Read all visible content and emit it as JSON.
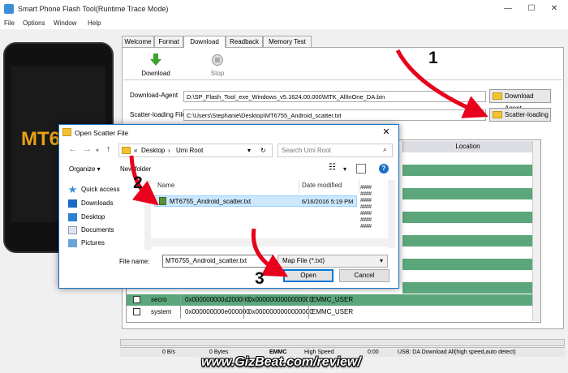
{
  "window": {
    "title": "Smart Phone Flash Tool(Runtime Trace Mode)",
    "minimize_icon": "minimize-icon",
    "maximize_icon": "maximize-icon",
    "close_glyph": "✕"
  },
  "menu": [
    "File",
    "Options",
    "Window",
    "Help"
  ],
  "phone": {
    "logo": "MT6"
  },
  "tabs": [
    "Welcome",
    "Format",
    "Download",
    "Readback",
    "Memory Test"
  ],
  "active_tab": "Download",
  "toolbar": {
    "download": "Download",
    "stop": "Stop"
  },
  "download_agent": {
    "label": "Download-Agent",
    "value": "D:\\SP_Flash_Tool_exe_Windows_v5.1624.00.000\\MTK_AllInOne_DA.bin",
    "button": "Download Agent"
  },
  "scatter": {
    "label": "Scatter-loading File",
    "value": "C:\\Users\\Stephanie\\Desktop\\MT6755_Android_scatter.txt",
    "button": "Scatter-loading"
  },
  "partition_table": {
    "location_header": "Location",
    "rows": [
      {
        "name": "secro",
        "begin": "0x000000000d200000",
        "end": "0x0000000000000000",
        "region": "EMMC_USER"
      },
      {
        "name": "system",
        "begin": "0x000000000e000000",
        "end": "0x0000000000000000",
        "region": "EMMC_USER"
      }
    ]
  },
  "status_bar": {
    "speed": "0 B/s",
    "bytes": "0 Bytes",
    "storage": "EMMC",
    "mode": "High Speed",
    "time": "0:00",
    "usb": "USB: DA Download All(high speed,auto detect)"
  },
  "dialog": {
    "title": "Open Scatter File",
    "breadcrumb": [
      "Desktop",
      "Umi Root"
    ],
    "search_placeholder": "Search Umi Root",
    "organize": "Organize ▾",
    "new_folder": "New folder",
    "nav_items": [
      "Quick access",
      "Downloads",
      "Desktop",
      "Documents",
      "Pictures"
    ],
    "columns": {
      "name": "Name",
      "date": "Date modified"
    },
    "file": {
      "name": "MT6755_Android_scatter.txt",
      "date": "6/16/2016 5:19 PM"
    },
    "hash_glyphs": "####",
    "file_name_label": "File name:",
    "file_name_value": "MT6755_Android_scatter.txt",
    "filter": "Map File (*.txt)",
    "open_button": "Open",
    "cancel_button": "Cancel"
  },
  "annotations": {
    "step1": "1",
    "step2": "2",
    "step3": "3",
    "arrow_color": "#e8001c"
  },
  "watermark": "www.GizBeat.com/review/"
}
